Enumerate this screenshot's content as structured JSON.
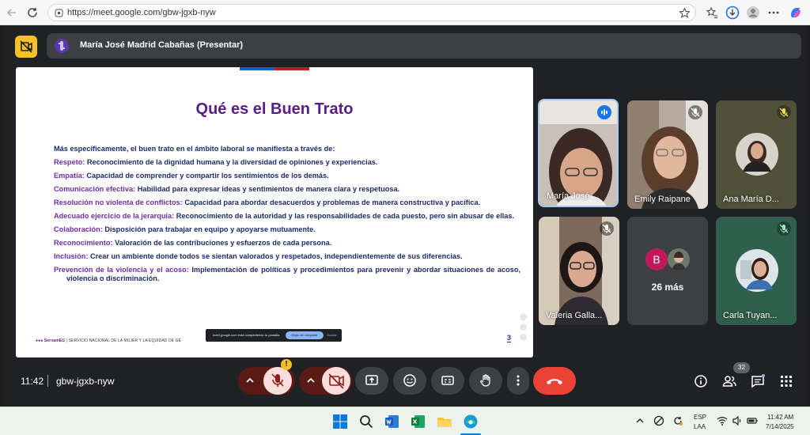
{
  "browser": {
    "url": "https://meet.google.com/gbw-jgxb-nyw",
    "icons": [
      "back-icon",
      "reload-icon",
      "site-info-icon",
      "star-icon",
      "favorites-icon",
      "downloads-icon",
      "profile-icon",
      "more-icon",
      "copilot-icon"
    ]
  },
  "meet": {
    "presenter_label": "María José Madrid Cabañas (Presentar)",
    "time": "11:42",
    "meeting_code": "gbw-jgxb-nyw",
    "participant_count": "32",
    "more_participants": "26 más",
    "more_avatar_letter": "B",
    "warning_badge": "!",
    "tiles": [
      {
        "name": "María José ...",
        "speaking": true
      },
      {
        "name": "Emily Raipane",
        "muted": true
      },
      {
        "name": "Ana María D...",
        "muted": true
      },
      {
        "name": "Valeria Galla...",
        "muted": true
      },
      {
        "name": "Carla Tuyan...",
        "muted": true
      }
    ]
  },
  "slide": {
    "title": "Qué es el Buen Trato",
    "intro": "Más específicamente, el buen trato en el ámbito laboral se manifiesta a través de:",
    "items": [
      {
        "key": "Respeto:",
        "text": " Reconocimiento de la dignidad humana y la diversidad de opiniones y experiencias."
      },
      {
        "key": "Empatía:",
        "text": " Capacidad de comprender y compartir los sentimientos de los demás."
      },
      {
        "key": "Comunicación efectiva:",
        "text": " Habilidad para expresar ideas y sentimientos de manera clara y respetuosa."
      },
      {
        "key": "Resolución no violenta de conflictos:",
        "text": " Capacidad para abordar desacuerdos y problemas de manera constructiva y pacífica."
      },
      {
        "key": "Adecuado ejercicio de la jerarquía:",
        "text": " Reconocimiento de la autoridad y las responsabilidades de cada puesto, pero sin abusar de ellas."
      },
      {
        "key": "Colaboración:",
        "text": " Disposición para trabajar en equipo y apoyarse mutuamente."
      },
      {
        "key": "Reconocimiento:",
        "text": " Valoración de las contribuciones y esfuerzos de cada persona."
      },
      {
        "key": "Inclusión:",
        "text": " Crear un ambiente donde todos se sientan valorados y respetados, independientemente de sus diferencias."
      },
      {
        "key": "Prevención de la violencia y el acoso:",
        "text": " Implementación de políticas y procedimientos para prevenir y abordar situaciones de acoso, violencia o discriminación."
      }
    ],
    "footer_brand": "SernamEG",
    "footer_text": "| SERVICIO NACIONAL DE LA MUJER Y LA EQUIDAD DE GÉ",
    "page_number": "3",
    "share_text": "meet.google.com está compartiendo tu pantalla.",
    "share_stop": "Dejar de compartir",
    "share_hide": "Ocultar"
  },
  "taskbar": {
    "lang_line1": "ESP",
    "lang_line2": "LAA",
    "time": "11:42 AM",
    "date": "7/14/2025"
  },
  "colors": {
    "slide_title": "#5a1d86",
    "leave_button": "#ea4335",
    "meet_bg": "#202124",
    "tile_bg": "#3c4043"
  }
}
